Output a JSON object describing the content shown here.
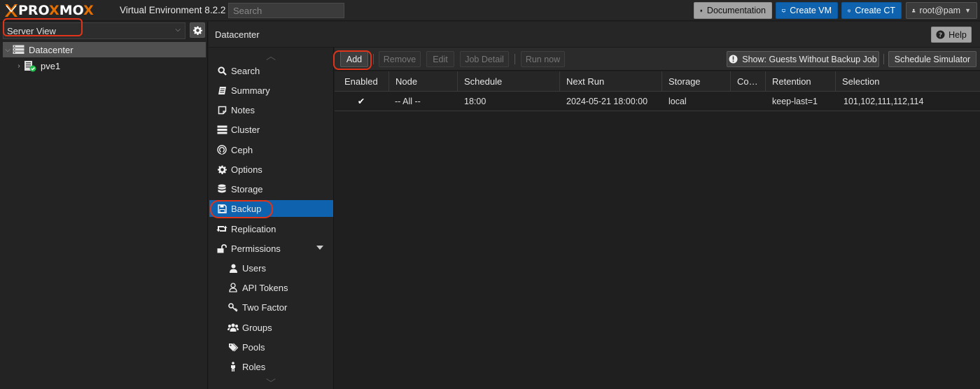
{
  "topbar": {
    "logo_text": "PROXMOX",
    "version": "Virtual Environment 8.2.2",
    "search_placeholder": "Search",
    "documentation_label": "Documentation",
    "create_vm_label": "Create VM",
    "create_ct_label": "Create CT",
    "user_label": "root@pam"
  },
  "tree": {
    "view_label": "Server View",
    "nodes": [
      {
        "label": "Datacenter",
        "icon": "datacenter-icon",
        "selected": true
      },
      {
        "label": "pve1",
        "icon": "server-online-icon"
      }
    ]
  },
  "main": {
    "title": "Datacenter",
    "help_label": "Help"
  },
  "nav": {
    "items": [
      {
        "label": "Search",
        "icon": "search-icon"
      },
      {
        "label": "Summary",
        "icon": "summary-icon"
      },
      {
        "label": "Notes",
        "icon": "notes-icon"
      },
      {
        "label": "Cluster",
        "icon": "cluster-icon"
      },
      {
        "label": "Ceph",
        "icon": "ceph-icon"
      },
      {
        "label": "Options",
        "icon": "gear-icon"
      },
      {
        "label": "Storage",
        "icon": "database-icon"
      },
      {
        "label": "Backup",
        "icon": "floppy-icon",
        "active": true
      },
      {
        "label": "Replication",
        "icon": "retweet-icon"
      },
      {
        "label": "Permissions",
        "icon": "unlock-icon",
        "expanded": true
      },
      {
        "label": "Users",
        "icon": "user-icon"
      },
      {
        "label": "API Tokens",
        "icon": "user-outline-icon"
      },
      {
        "label": "Two Factor",
        "icon": "key-icon"
      },
      {
        "label": "Groups",
        "icon": "users-icon"
      },
      {
        "label": "Pools",
        "icon": "tags-icon"
      },
      {
        "label": "Roles",
        "icon": "male-icon"
      }
    ]
  },
  "toolbar": {
    "add": "Add",
    "remove": "Remove",
    "edit": "Edit",
    "job_detail": "Job Detail",
    "run_now": "Run now",
    "show_guests": "Show: Guests Without Backup Job",
    "schedule_simulator": "Schedule Simulator"
  },
  "grid": {
    "columns": [
      "Enabled",
      "Node",
      "Schedule",
      "Next Run",
      "Storage",
      "Co…",
      "Retention",
      "Selection"
    ],
    "rows": [
      {
        "enabled": "✔",
        "node": "-- All --",
        "schedule": "18:00",
        "next_run": "2024-05-21 18:00:00",
        "storage": "local",
        "comment": "",
        "retention": "keep-last=1",
        "selection": "101,102,111,112,114"
      }
    ]
  },
  "colors": {
    "accent": "#0f62ae",
    "logo_orange": "#e57000",
    "highlight_ring": "#e0341a"
  }
}
